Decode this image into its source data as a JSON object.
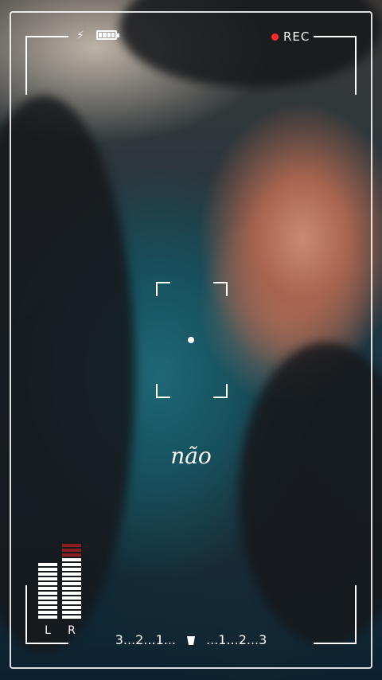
{
  "status_bar": {
    "flash_icon": "lightning-icon",
    "battery_icon": "battery-full-icon",
    "rec_indicator_color": "#ff2a2a",
    "rec_label": "REC"
  },
  "viewfinder": {
    "focus_icon": "focus-point-icon"
  },
  "subtitle": "não",
  "audio_meter": {
    "left_label": "L",
    "right_label": "R",
    "left_level": 0.78,
    "right_level": 1.0,
    "peak_color": "#8b1c22"
  },
  "countdown": {
    "left_text": "3...2...1...",
    "center_icon": "cup-icon",
    "right_text": "...1...2...3"
  }
}
